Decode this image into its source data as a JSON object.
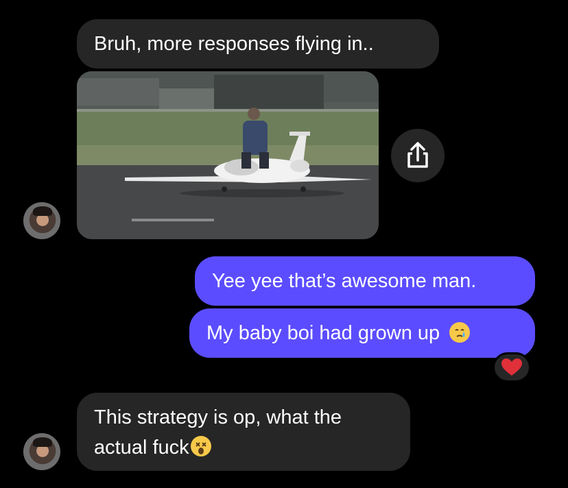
{
  "messages": [
    {
      "from": "them",
      "text": "Bruh, more responses flying in.."
    },
    {
      "from": "them",
      "type": "image"
    },
    {
      "from": "me",
      "text": "Yee yee that’s awesome man."
    },
    {
      "from": "me",
      "text": "My baby boi had grown up",
      "emoji": "crying-face-emoji",
      "reaction": "red-heart-emoji"
    },
    {
      "from": "them",
      "text": "This strategy is op, what the actual fuck",
      "emoji": "dizzy-face-emoji"
    }
  ],
  "share_icon": "share-icon",
  "colors": {
    "incoming_bubble": "#262626",
    "outgoing_bubble": "#5b4dff",
    "background": "#000000"
  }
}
